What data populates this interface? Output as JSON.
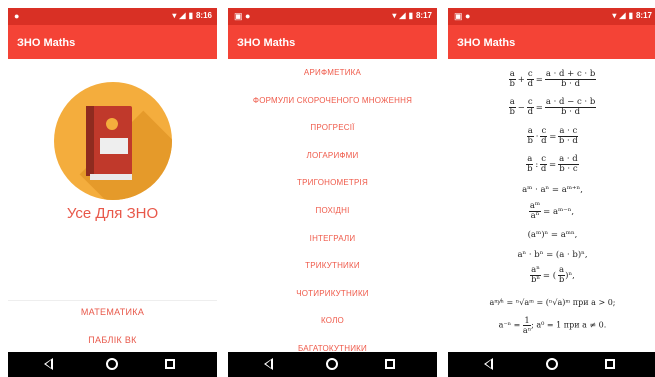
{
  "status": {
    "time_1": "8:16",
    "time_2": "8:17",
    "time_3": "8:17"
  },
  "app": {
    "title": "ЗНО Maths"
  },
  "screen1": {
    "app_name": "Усе Для ЗНО",
    "buttons": [
      "МАТЕМАТИКА",
      "ПАБЛІК ВК"
    ]
  },
  "screen2": {
    "topics": [
      "АРИФМЕТИКА",
      "ФОРМУЛИ СКОРОЧЕНОГО МНОЖЕННЯ",
      "ПРОГРЕСІЇ",
      "ЛОГАРИФМИ",
      "ТРИГОНОМЕТРІЯ",
      "ПОХІДНІ",
      "ІНТЕГРАЛИ",
      "ТРИКУТНИКИ",
      "ЧОТИРИКУТНИКИ",
      "КОЛО",
      "БАГАТОКУТНИКИ"
    ]
  },
  "screen3": {
    "f1": {
      "a": "a",
      "b": "b",
      "c": "c",
      "d": "d",
      "op": "+",
      "num": "a · d + c · b",
      "den": "b · d"
    },
    "f2": {
      "a": "a",
      "b": "b",
      "c": "c",
      "d": "d",
      "op": "−",
      "num": "a · d − c · b",
      "den": "b · d"
    },
    "f3": {
      "a": "a",
      "b": "b",
      "c": "c",
      "d": "d",
      "op": "·",
      "num": "a · c",
      "den": "b · d"
    },
    "f4": {
      "a": "a",
      "b": "b",
      "c": "c",
      "d": "d",
      "op": ":",
      "num": "a · d",
      "den": "b · c"
    },
    "f5": "aᵐ · aⁿ = aᵐ⁺ⁿ,",
    "f6": {
      "num": "aᵐ",
      "den": "aⁿ",
      "rhs": "= aᵐ⁻ⁿ,"
    },
    "f7": "(aᵐ)ⁿ = aᵐⁿ,",
    "f8": "aⁿ · bⁿ = (a · b)ⁿ,",
    "f9": {
      "num": "aⁿ",
      "den": "bⁿ",
      "rhs_num": "a",
      "rhs_den": "b",
      "tail": ")ⁿ,"
    },
    "f10": "aᵐ⁄ⁿ = ⁿ√aᵐ = (ⁿ√a)ᵐ  при  a > 0;",
    "f11": {
      "lhs": "a⁻ⁿ =",
      "num": "1",
      "den": "aⁿ",
      "tail": ";  a⁰ = 1  при  a ≠ 0."
    }
  }
}
